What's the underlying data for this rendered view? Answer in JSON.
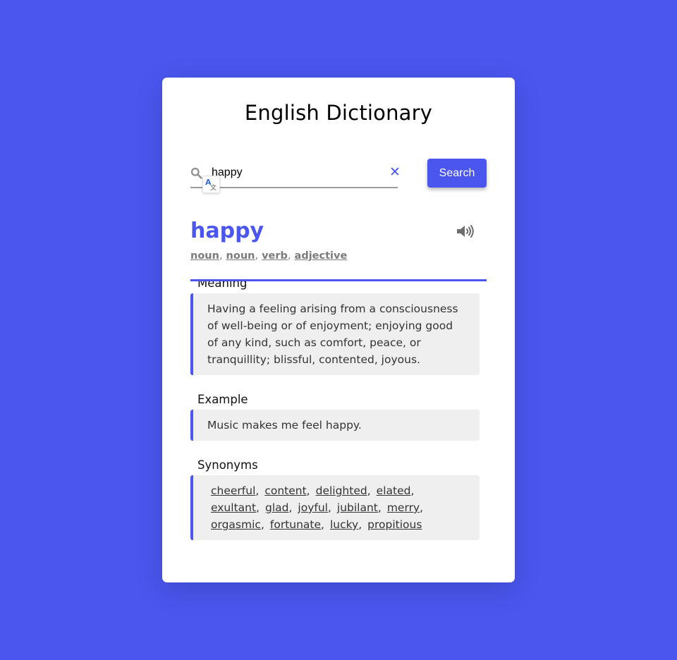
{
  "app": {
    "title": "English Dictionary"
  },
  "search": {
    "value": "happy",
    "button_label": "Search",
    "clear_glyph": "✕"
  },
  "entry": {
    "word": "happy",
    "parts_of_speech": [
      "noun",
      "noun",
      "verb",
      "adjective"
    ],
    "meaning_label": "Meaning",
    "meaning": "Having a feeling arising from a consciousness of well-being or of enjoyment; enjoying good of any kind, such as comfort, peace, or tranquillity; blissful, contented, joyous.",
    "example_label": "Example",
    "example": "Music makes me feel happy.",
    "synonyms_label": "Synonyms",
    "synonyms": [
      "cheerful",
      "content",
      "delighted",
      "elated",
      "exultant",
      "glad",
      "joyful",
      "jubilant",
      "merry",
      "orgasmic",
      "fortunate",
      "lucky",
      "propitious"
    ]
  },
  "icons": {
    "search": "magnifier-icon",
    "clear": "close-icon",
    "translate": "translate-icon",
    "audio": "speaker-icon"
  },
  "colors": {
    "accent": "#4a56ee",
    "background": "#4a56ee",
    "card": "#ffffff",
    "panel": "#efefef"
  }
}
